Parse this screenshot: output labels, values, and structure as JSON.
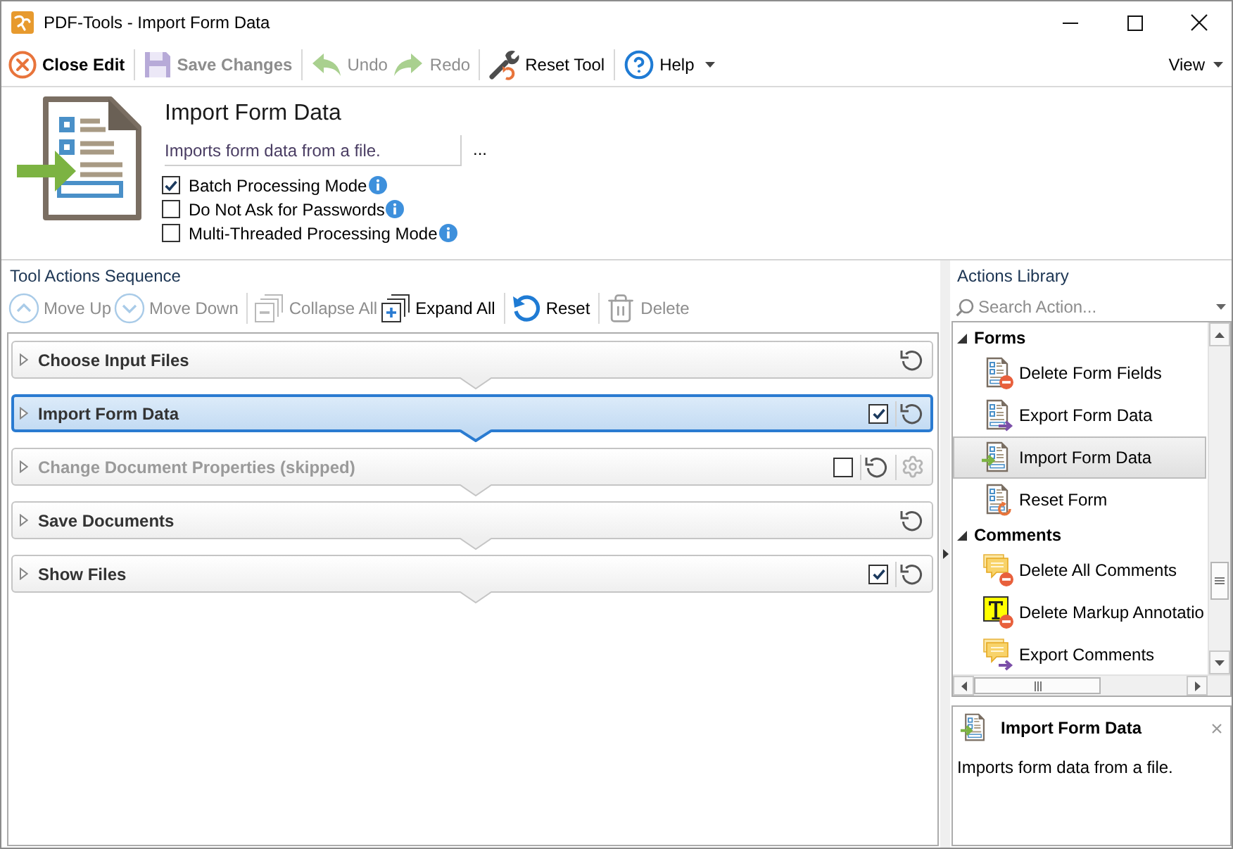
{
  "window": {
    "title": "PDF-Tools - Import Form Data"
  },
  "toolbar": {
    "groups": [
      [
        {
          "kind": "close",
          "label": "Close Edit",
          "disabled": false
        }
      ],
      [
        {
          "kind": "save",
          "label": "Save Changes",
          "disabled": true
        }
      ],
      [
        {
          "kind": "undo",
          "label": "Undo",
          "disabled": true
        },
        {
          "kind": "redo",
          "label": "Redo",
          "disabled": true
        }
      ],
      [
        {
          "kind": "tool",
          "label": "Reset Tool",
          "disabled": false
        }
      ],
      [
        {
          "kind": "help",
          "label": "Help",
          "disabled": false,
          "menu": true
        }
      ]
    ],
    "view": {
      "label": "View",
      "menu": true
    }
  },
  "tool": {
    "title": "Import Form Data",
    "description": "Imports form data from a file.",
    "browse": "...",
    "options": [
      {
        "label": "Batch Processing Mode",
        "checked": true
      },
      {
        "label": "Do Not Ask for Passwords",
        "checked": false
      },
      {
        "label": "Multi-Threaded Processing Mode",
        "checked": false
      }
    ]
  },
  "sequence": {
    "title": "Tool Actions Sequence",
    "toolbar": {
      "groups": [
        [
          {
            "kind": "up",
            "label": "Move Up",
            "disabled": true
          },
          {
            "kind": "down",
            "label": "Move Down",
            "disabled": true
          }
        ],
        [
          {
            "kind": "collapse",
            "label": "Collapse All",
            "disabled": true
          },
          {
            "kind": "expand",
            "label": "Expand All",
            "disabled": false
          }
        ],
        [
          {
            "kind": "reset",
            "label": "Reset",
            "disabled": false
          }
        ],
        [
          {
            "kind": "delete",
            "label": "Delete",
            "disabled": true
          }
        ]
      ]
    },
    "actions": [
      {
        "label": "Choose Input Files",
        "selected": false,
        "expanded": false
      },
      {
        "label": "Import Form Data",
        "selected": true,
        "expanded": false,
        "checked": true
      },
      {
        "label": "Change Document Properties (skipped)",
        "selected": false,
        "expanded": false,
        "checked": false,
        "settings": true
      },
      {
        "label": "Save Documents",
        "selected": false,
        "expanded": false
      },
      {
        "label": "Show Files",
        "selected": false,
        "expanded": false,
        "checked": true
      }
    ]
  },
  "library": {
    "title": "Actions Library",
    "search": {
      "placeholder": "Search Action..."
    },
    "groups": [
      {
        "label": "Forms",
        "kind": "form",
        "expanded": true,
        "items": [
          {
            "label": "Delete Form Fields",
            "kind": "delete",
            "selected": false
          },
          {
            "label": "Export Form Data",
            "kind": "export",
            "selected": false
          },
          {
            "label": "Import Form Data",
            "kind": "import",
            "selected": true
          },
          {
            "label": "Reset Form",
            "kind": "reset",
            "selected": false
          }
        ]
      },
      {
        "label": "Comments",
        "kind": "comment",
        "expanded": true,
        "items": [
          {
            "label": "Delete All Comments",
            "kind": "delete",
            "selected": false
          },
          {
            "label": "Delete Markup Annotatio",
            "kind": "markup",
            "selected": false
          },
          {
            "label": "Export Comments",
            "kind": "export",
            "selected": false
          }
        ]
      }
    ]
  },
  "details": {
    "title": "Import Form Data",
    "description": "Imports form data from a file."
  }
}
